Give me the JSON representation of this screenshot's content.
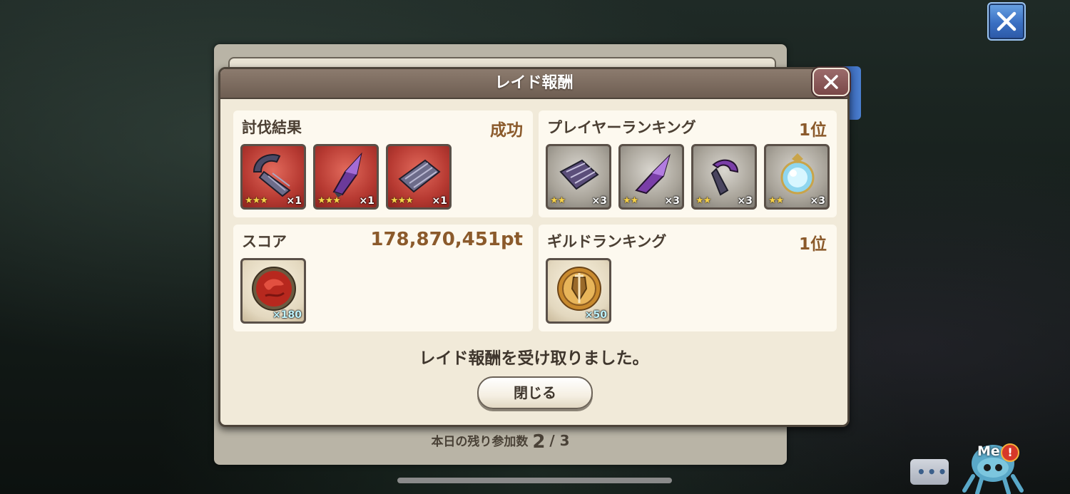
{
  "window": {
    "title": "レイド報酬"
  },
  "sections": {
    "subjugation": {
      "label": "討伐結果",
      "result": "成功",
      "items": [
        {
          "name": "claw",
          "stars": "★★★",
          "qty": "×1"
        },
        {
          "name": "crystal",
          "stars": "★★★",
          "qty": "×1"
        },
        {
          "name": "scale",
          "stars": "★★★",
          "qty": "×1"
        }
      ]
    },
    "player_ranking": {
      "label": "プレイヤーランキング",
      "rank": "1位",
      "items": [
        {
          "name": "scale",
          "stars": "★★",
          "qty": "×3"
        },
        {
          "name": "crystal",
          "stars": "★★",
          "qty": "×3"
        },
        {
          "name": "claw",
          "stars": "★★",
          "qty": "×3"
        },
        {
          "name": "orb",
          "stars": "★★",
          "qty": "×3"
        }
      ]
    },
    "score": {
      "label": "スコア",
      "value": "178,870,451pt",
      "items": [
        {
          "name": "red-orb",
          "qty": "×180"
        }
      ]
    },
    "guild_ranking": {
      "label": "ギルドランキング",
      "rank": "1位",
      "items": [
        {
          "name": "medal",
          "qty": "×50"
        }
      ]
    }
  },
  "message": "レイド報酬を受け取りました。",
  "close_button": "閉じる",
  "remaining": {
    "label": "本日の残り参加数",
    "current": "2",
    "total": "/ 3"
  },
  "overlay": {
    "mascot_label": "Me",
    "mascot_badge": "!"
  },
  "colors": {
    "accent": "#8b5a2b",
    "item_red": "#b73a32",
    "item_grey": "#a9a49a",
    "star": "#f7d24a"
  }
}
